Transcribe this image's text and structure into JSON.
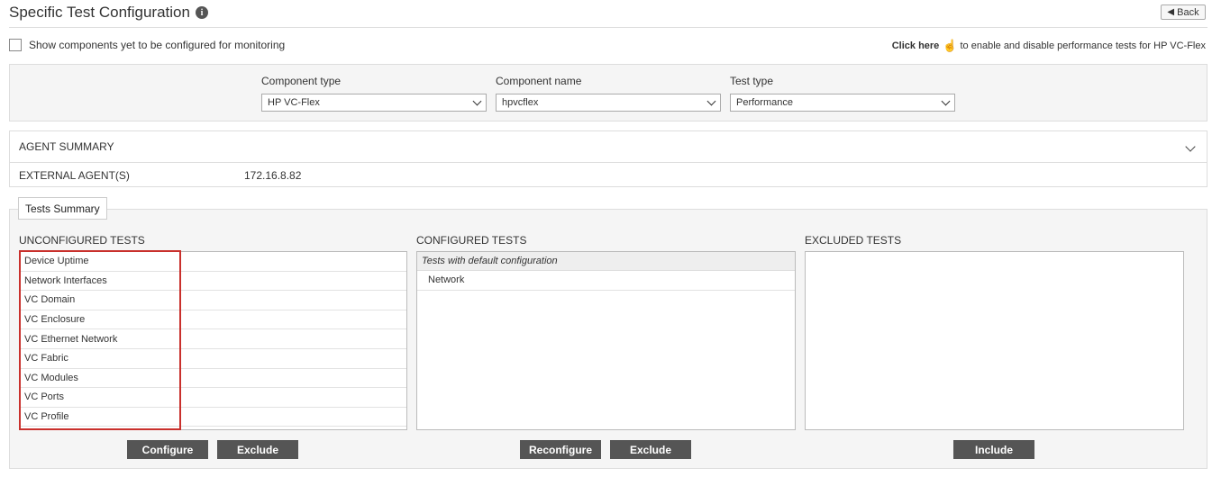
{
  "header": {
    "title": "Specific Test Configuration",
    "info_glyph": "i",
    "back_label": "Back"
  },
  "show_components_label": "Show components yet to be configured for monitoring",
  "click_here": {
    "link": "Click here",
    "text": "to enable and disable performance tests for HP VC-Flex"
  },
  "filters": {
    "component_type": {
      "label": "Component type",
      "value": "HP VC-Flex"
    },
    "component_name": {
      "label": "Component name",
      "value": "hpvcflex"
    },
    "test_type": {
      "label": "Test type",
      "value": "Performance"
    }
  },
  "agent_summary": {
    "title": "AGENT SUMMARY",
    "row_label": "EXTERNAL AGENT(S)",
    "row_value": "172.16.8.82"
  },
  "tests_summary": {
    "tab_label": "Tests Summary",
    "unconfigured": {
      "title": "UNCONFIGURED TESTS",
      "items": [
        "Device Uptime",
        "Network Interfaces",
        "VC Domain",
        "VC Enclosure",
        "VC Ethernet Network",
        "VC Fabric",
        "VC Modules",
        "VC Ports",
        "VC Profile"
      ],
      "buttons": [
        "Configure",
        "Exclude"
      ]
    },
    "configured": {
      "title": "CONFIGURED TESTS",
      "group": "Tests with default configuration",
      "items": [
        "Network"
      ],
      "buttons": [
        "Reconfigure",
        "Exclude"
      ]
    },
    "excluded": {
      "title": "EXCLUDED TESTS",
      "items": [],
      "buttons": [
        "Include"
      ]
    }
  },
  "colors": {
    "button_bg": "#555555",
    "highlight_border": "#c9302c",
    "panel_bg": "#f5f5f5"
  }
}
